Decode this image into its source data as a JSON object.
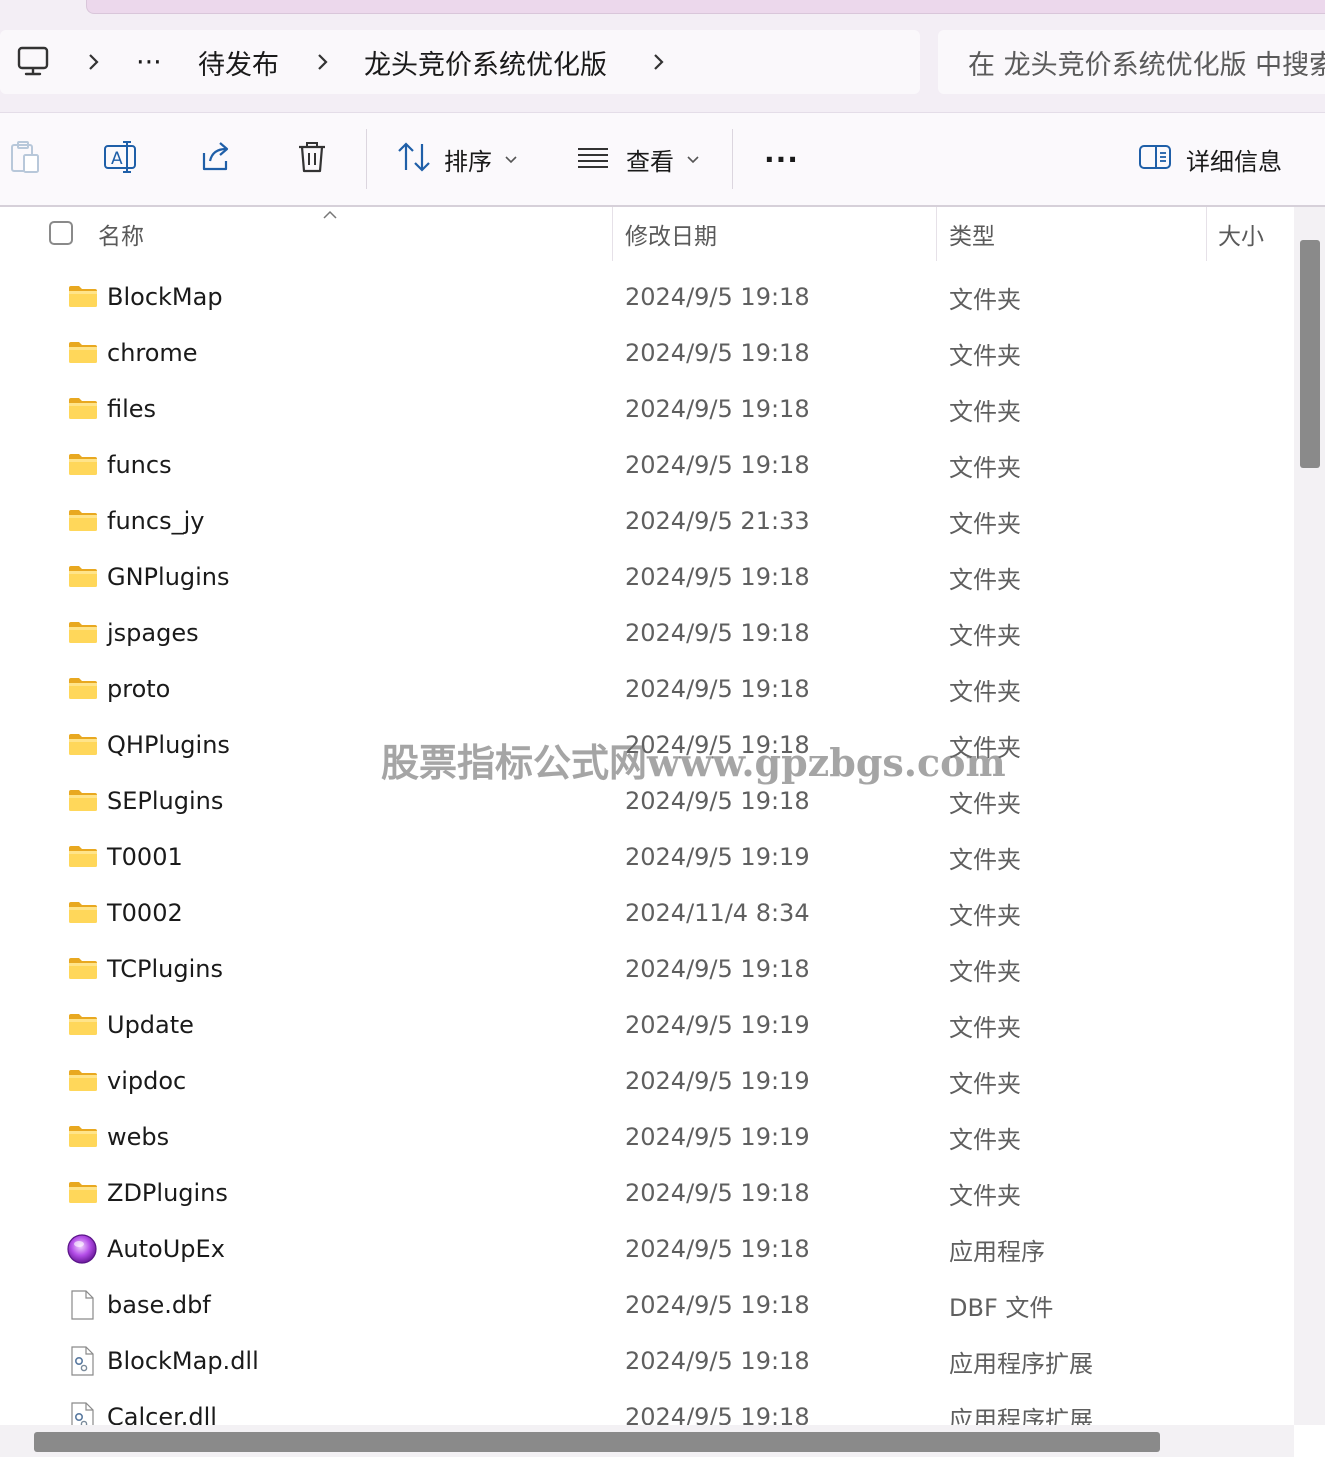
{
  "address_bar": {
    "overflow_label": "···",
    "crumbs": [
      "待发布",
      "龙头竞价系统优化版"
    ]
  },
  "search": {
    "placeholder": "在 龙头竞价系统优化版 中搜索"
  },
  "toolbar": {
    "sort_label": "排序",
    "view_label": "查看",
    "more_label": "···",
    "details_label": "详细信息"
  },
  "columns": {
    "name": "名称",
    "date": "修改日期",
    "type": "类型",
    "size": "大小"
  },
  "watermark": "股票指标公式网www.gpzbgs.com",
  "files": [
    {
      "name": "BlockMap",
      "date": "2024/9/5 19:18",
      "type": "文件夹",
      "icon": "folder-icon"
    },
    {
      "name": "chrome",
      "date": "2024/9/5 19:18",
      "type": "文件夹",
      "icon": "folder-icon"
    },
    {
      "name": "files",
      "date": "2024/9/5 19:18",
      "type": "文件夹",
      "icon": "folder-icon"
    },
    {
      "name": "funcs",
      "date": "2024/9/5 19:18",
      "type": "文件夹",
      "icon": "folder-icon"
    },
    {
      "name": "funcs_jy",
      "date": "2024/9/5 21:33",
      "type": "文件夹",
      "icon": "folder-icon"
    },
    {
      "name": "GNPlugins",
      "date": "2024/9/5 19:18",
      "type": "文件夹",
      "icon": "folder-icon"
    },
    {
      "name": "jspages",
      "date": "2024/9/5 19:18",
      "type": "文件夹",
      "icon": "folder-icon"
    },
    {
      "name": "proto",
      "date": "2024/9/5 19:18",
      "type": "文件夹",
      "icon": "folder-icon"
    },
    {
      "name": "QHPlugins",
      "date": "2024/9/5 19:18",
      "type": "文件夹",
      "icon": "folder-icon"
    },
    {
      "name": "SEPlugins",
      "date": "2024/9/5 19:18",
      "type": "文件夹",
      "icon": "folder-icon"
    },
    {
      "name": "T0001",
      "date": "2024/9/5 19:19",
      "type": "文件夹",
      "icon": "folder-icon"
    },
    {
      "name": "T0002",
      "date": "2024/11/4 8:34",
      "type": "文件夹",
      "icon": "folder-icon"
    },
    {
      "name": "TCPlugins",
      "date": "2024/9/5 19:18",
      "type": "文件夹",
      "icon": "folder-icon"
    },
    {
      "name": "Update",
      "date": "2024/9/5 19:19",
      "type": "文件夹",
      "icon": "folder-icon"
    },
    {
      "name": "vipdoc",
      "date": "2024/9/5 19:19",
      "type": "文件夹",
      "icon": "folder-icon"
    },
    {
      "name": "webs",
      "date": "2024/9/5 19:19",
      "type": "文件夹",
      "icon": "folder-icon"
    },
    {
      "name": "ZDPlugins",
      "date": "2024/9/5 19:18",
      "type": "文件夹",
      "icon": "folder-icon"
    },
    {
      "name": "AutoUpEx",
      "date": "2024/9/5 19:18",
      "type": "应用程序",
      "icon": "app-icon"
    },
    {
      "name": "base.dbf",
      "date": "2024/9/5 19:18",
      "type": "DBF 文件",
      "icon": "file-icon"
    },
    {
      "name": "BlockMap.dll",
      "date": "2024/9/5 19:18",
      "type": "应用程序扩展",
      "icon": "dll-icon"
    },
    {
      "name": "Calcer.dll",
      "date": "2024/9/5 19:18",
      "type": "应用程序扩展",
      "icon": "dll-icon"
    }
  ]
}
